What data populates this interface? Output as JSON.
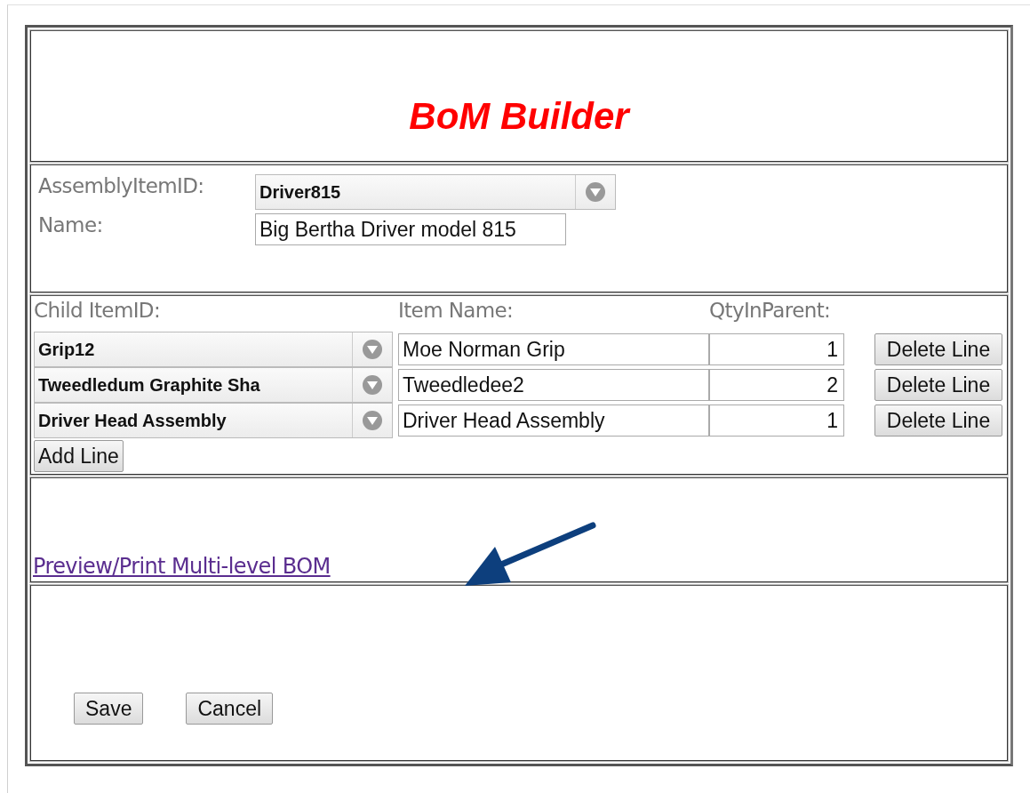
{
  "title": "BoM Builder",
  "assembly": {
    "id_label": "AssemblyItemID:",
    "id_value": "Driver815",
    "name_label": "Name:",
    "name_value": "Big Bertha Driver model 815"
  },
  "lines": {
    "columns": [
      "Child ItemID:",
      "Item Name:",
      "QtyInParent:"
    ],
    "rows": [
      {
        "child_item": "Grip12",
        "item_name": "Moe Norman Grip",
        "qty": "1",
        "delete": "Delete Line"
      },
      {
        "child_item": "Tweedledum Graphite Sha",
        "item_name": "Tweedledee2",
        "qty": "2",
        "delete": "Delete Line"
      },
      {
        "child_item": "Driver Head Assembly",
        "item_name": "Driver Head Assembly",
        "qty": "1",
        "delete": "Delete Line"
      }
    ],
    "add_button": "Add Line"
  },
  "preview_link": "Preview/Print Multi-level BOM",
  "buttons": [
    "Save",
    "Cancel"
  ]
}
